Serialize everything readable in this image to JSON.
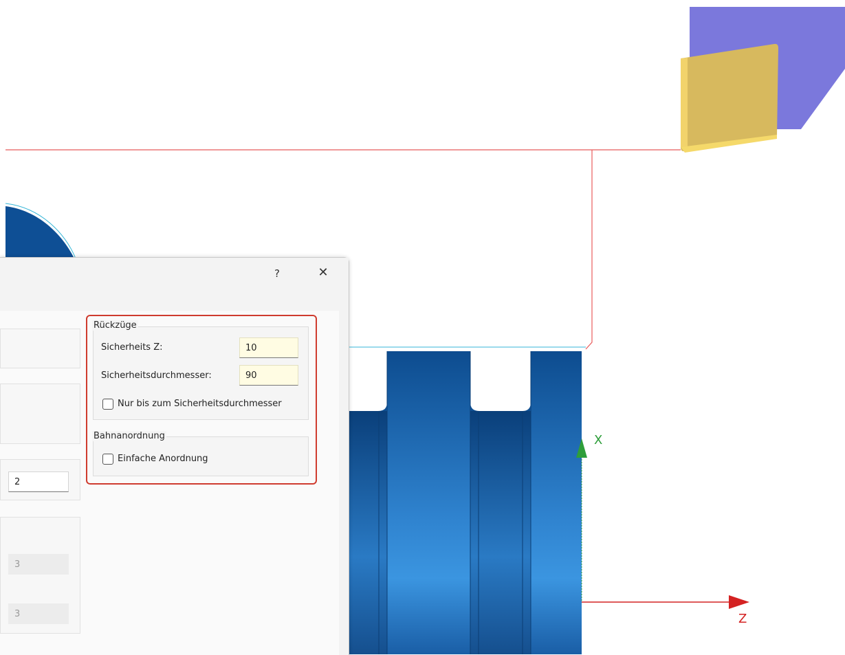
{
  "colors": {
    "part_blue": "#1f69b0",
    "toolpath_red": "#e23b3b",
    "stock_cyan": "#35b6d8",
    "tool_holder": "#7b78dc",
    "tool_insert": "#d9b85a",
    "axis_x_green": "#2e9e3a",
    "axis_z_red": "#d42222",
    "highlight": "#cf3b2e"
  },
  "viewport": {
    "axis_x_label": "X",
    "axis_z_label": "Z"
  },
  "dialog": {
    "help_label": "?",
    "close_label": "✕",
    "left_fields": {
      "field_a": "2",
      "field_b": "3",
      "field_c": "3"
    },
    "retracts": {
      "title": "Rückzüge",
      "safety_z_label": "Sicherheits Z:",
      "safety_z_value": "10",
      "safety_diameter_label": "Sicherheitsdurchmesser:",
      "safety_diameter_value": "90",
      "only_to_safety_label": "Nur bis zum Sicherheitsdurchmesser",
      "only_to_safety_checked": false
    },
    "path_arrangement": {
      "title": "Bahnanordnung",
      "simple_label": "Einfache Anordnung",
      "simple_checked": false
    }
  }
}
